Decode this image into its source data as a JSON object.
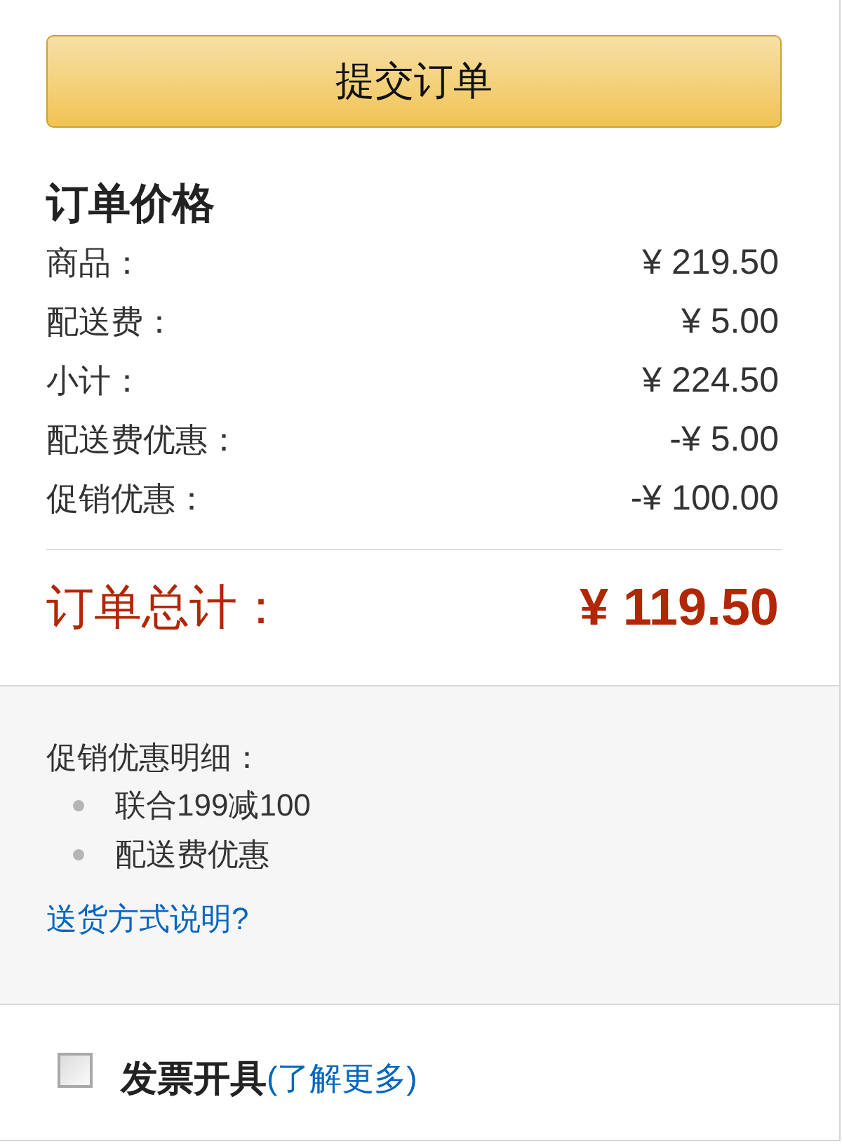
{
  "submit_button": {
    "label": "提交订单"
  },
  "order_price": {
    "title": "订单价格",
    "rows": [
      {
        "label": "商品：",
        "amount": "¥ 219.50"
      },
      {
        "label": "配送费：",
        "amount": "¥ 5.00"
      },
      {
        "label": "小计：",
        "amount": "¥ 224.50"
      },
      {
        "label": "配送费优惠：",
        "amount": "-¥ 5.00"
      },
      {
        "label": "促销优惠：",
        "amount": "-¥ 100.00"
      }
    ],
    "total": {
      "label": "订单总计：",
      "amount": "¥ 119.50"
    }
  },
  "promotion_details": {
    "title": "促销优惠明细：",
    "items": [
      "联合199减100",
      "配送费优惠"
    ],
    "link": "送货方式说明?"
  },
  "invoice": {
    "checked": false,
    "label": "发票开具",
    "link": "(了解更多)"
  }
}
